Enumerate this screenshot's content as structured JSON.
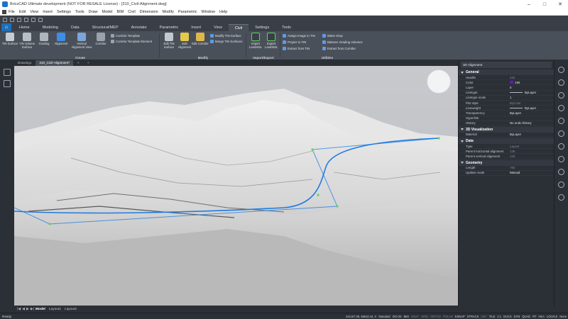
{
  "window": {
    "title": "BricsCAD Ultimate development (NOT FOR RESALE License) - [310_Civil-Alignment.dwg]"
  },
  "menu": [
    "File",
    "Edit",
    "View",
    "Insert",
    "Settings",
    "Tools",
    "Draw",
    "Model",
    "BIM",
    "Civil",
    "Dimension",
    "Modify",
    "Parametric",
    "Window",
    "Help"
  ],
  "ribbon_tabs": [
    "Home",
    "Modeling",
    "Data",
    "Structural/MEP",
    "Annotate",
    "Parametric",
    "Insert",
    "View",
    "Civil",
    "Settings",
    "Tools"
  ],
  "ribbon": {
    "create": {
      "label": "Create",
      "buttons": [
        "TIN Surface",
        "TIN Volume Surface",
        "Grading",
        "Alignment",
        "Vertical Alignment View",
        "Corridor"
      ],
      "small": [
        "Corridor Template",
        "Corridor Template Element"
      ]
    },
    "modify": {
      "label": "Modify",
      "buttons": [
        "Edit TIN Surface",
        "Edit Alignment",
        "Edit Corridor"
      ],
      "small": [
        "Modify TIN Surface",
        "Merge TIN Surfaces"
      ]
    },
    "import_export": {
      "label": "Import/Export",
      "buttons": [
        "Import LandXML",
        "Export LandXML"
      ]
    },
    "utilities": {
      "label": "Utilities",
      "small": [
        "Assign Image to TIN",
        "Project to TIN",
        "Extract from TIN",
        "Water Drop",
        "Balance Grading Volumes",
        "Extract from Corridor"
      ]
    }
  },
  "doc_tabs": [
    "Drawing1",
    "310_Civil-Alignment*"
  ],
  "properties": {
    "selection": "3D Alignment",
    "sections": {
      "general": "General",
      "visualization": "3D Visualization",
      "data": "Data",
      "geometry": "Geometry"
    },
    "general_rows": [
      {
        "k": "Handle",
        "v": "434",
        "muted": true
      },
      {
        "k": "Color",
        "v": "190",
        "swatch": "#6b12c9"
      },
      {
        "k": "Layer",
        "v": "0"
      },
      {
        "k": "Linetype",
        "v": "ByLayer",
        "line": true
      },
      {
        "k": "Linetype scale",
        "v": "1"
      },
      {
        "k": "Plot style",
        "v": "ByColor",
        "muted": true
      },
      {
        "k": "Lineweight",
        "v": "ByLayer",
        "line": true
      },
      {
        "k": "Transparency",
        "v": "ByLayer"
      },
      {
        "k": "Hyperlink",
        "v": ""
      },
      {
        "k": "History",
        "v": "No undo history"
      }
    ],
    "visualization_rows": [
      {
        "k": "Material",
        "v": "ByLayer"
      }
    ],
    "data_rows": [
      {
        "k": "Type",
        "v": "Layout",
        "muted": true
      },
      {
        "k": "Parent horizontal alignment",
        "v": "136",
        "muted": true
      },
      {
        "k": "Parent vertical alignment",
        "v": "133",
        "muted": true
      }
    ],
    "geometry_rows": [
      {
        "k": "Length",
        "v": "783",
        "muted": true
      },
      {
        "k": "Update mode",
        "v": "Manual"
      }
    ]
  },
  "layout_tabs": [
    "Model",
    "Layout1",
    "Layout2"
  ],
  "status": {
    "ready": "Ready",
    "coords": "441157.39, 56610.44, 0",
    "items": [
      "Standard",
      "ISO-25",
      "BIM",
      "SNAP",
      "GRID",
      "ORTHO",
      "POLAR",
      "ESNAP",
      "STRACK",
      "LWT",
      "TILE",
      "1:1",
      "DUCS",
      "DYN",
      "QUAD",
      "RT",
      "HKA",
      "LOCKUI",
      "None"
    ],
    "off_items": [
      "SNAP",
      "GRID",
      "ORTHO",
      "POLAR",
      "LWT"
    ]
  },
  "colors": {
    "alignment": "#1f7be0",
    "accent": "#1f6fb8",
    "vertex": "#5fd35f"
  }
}
